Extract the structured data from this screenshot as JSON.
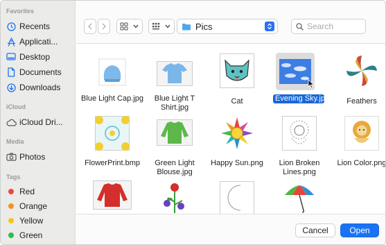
{
  "sidebar": {
    "favorites_label": "Favorites",
    "favorites": [
      {
        "label": "Recents",
        "icon": "clock-icon"
      },
      {
        "label": "Applicati...",
        "icon": "applications-icon"
      },
      {
        "label": "Desktop",
        "icon": "desktop-icon"
      },
      {
        "label": "Documents",
        "icon": "document-icon"
      },
      {
        "label": "Downloads",
        "icon": "download-icon"
      }
    ],
    "icloud_label": "iCloud",
    "icloud": [
      {
        "label": "iCloud Dri...",
        "icon": "cloud-icon"
      }
    ],
    "media_label": "Media",
    "media": [
      {
        "label": "Photos",
        "icon": "camera-icon"
      }
    ],
    "tags_label": "Tags",
    "tags": [
      {
        "label": "Red",
        "color": "#f0463b"
      },
      {
        "label": "Orange",
        "color": "#f7921d"
      },
      {
        "label": "Yellow",
        "color": "#f6c51b"
      },
      {
        "label": "Green",
        "color": "#2bbf47"
      }
    ]
  },
  "toolbar": {
    "location": "Pics",
    "search_placeholder": "Search"
  },
  "files": [
    {
      "name": "Blue Light Cap.jpg"
    },
    {
      "name": "Blue Light T Shirt.jpg"
    },
    {
      "name": "Cat"
    },
    {
      "name": "Evening Sky.jpg",
      "selected": true
    },
    {
      "name": "Feathers"
    },
    {
      "name": "FlowerPrint.bmp"
    },
    {
      "name": "Green Light Blouse.jpg"
    },
    {
      "name": "Happy Sun.png"
    },
    {
      "name": "Lion Broken Lines.png"
    },
    {
      "name": "Lion Color.png"
    },
    {
      "name": ""
    },
    {
      "name": ""
    },
    {
      "name": ""
    },
    {
      "name": ""
    }
  ],
  "footer": {
    "cancel_label": "Cancel",
    "open_label": "Open"
  },
  "colors": {
    "accent": "#1a73f4",
    "selection": "#1967d9"
  }
}
